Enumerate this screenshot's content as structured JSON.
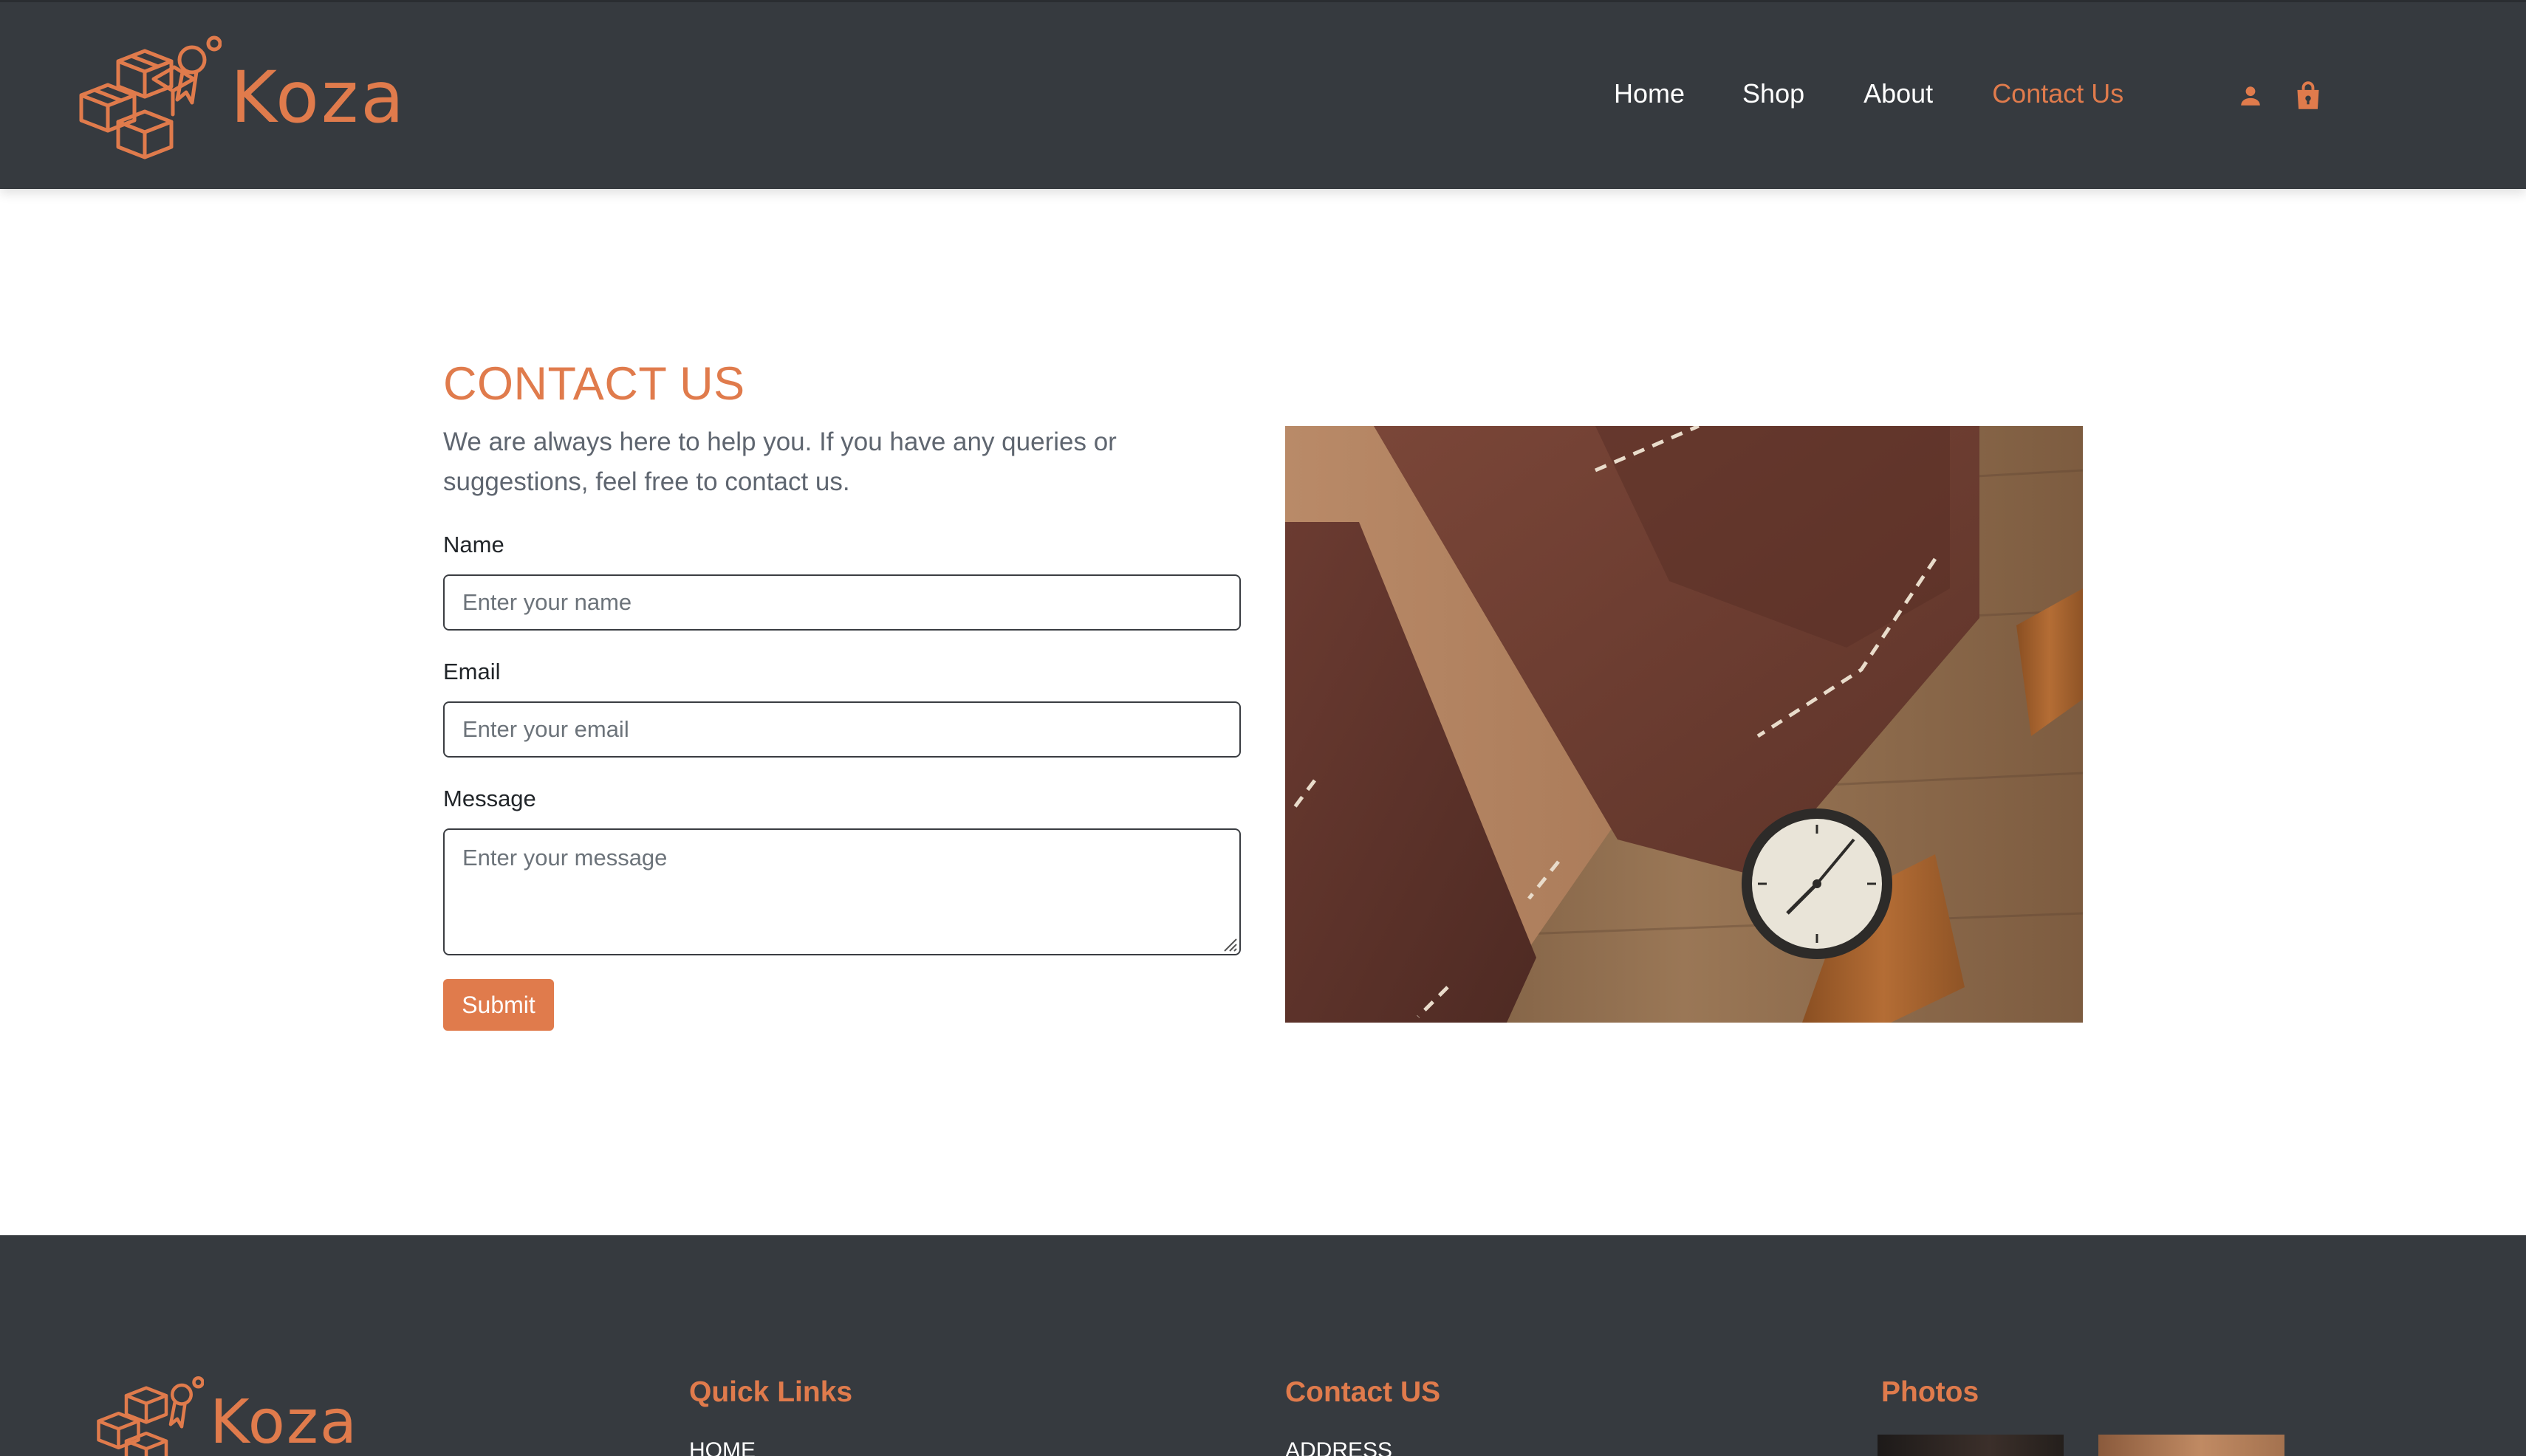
{
  "colors": {
    "accent": "#e07b4c",
    "header_bg": "#363a3f",
    "footer_bg": "#363a3f"
  },
  "header": {
    "logo_text": "Koza",
    "logo_icon": "boxes-logo-icon",
    "nav": [
      {
        "label": "Home",
        "active": false
      },
      {
        "label": "Shop",
        "active": false
      },
      {
        "label": "About",
        "active": false
      },
      {
        "label": "Contact Us",
        "active": true
      }
    ],
    "icons": [
      "user-icon",
      "shopping-bag-icon"
    ]
  },
  "contact": {
    "title": "CONTACT US",
    "intro": "We are always here to help you. If you have any queries or suggestions, feel free to contact us.",
    "fields": {
      "name": {
        "label": "Name",
        "placeholder": "Enter your name",
        "value": ""
      },
      "email": {
        "label": "Email",
        "placeholder": "Enter your email",
        "value": ""
      },
      "message": {
        "label": "Message",
        "placeholder": "Enter your message",
        "value": ""
      }
    },
    "submit_label": "Submit",
    "image": "leather-wallet-and-watch-photo"
  },
  "footer": {
    "logo_text": "Koza",
    "columns": {
      "quick_links": {
        "heading": "Quick Links",
        "items": [
          "HOME"
        ]
      },
      "contact": {
        "heading": "Contact US",
        "items": [
          "ADDRESS"
        ]
      },
      "photos": {
        "heading": "Photos"
      }
    }
  }
}
